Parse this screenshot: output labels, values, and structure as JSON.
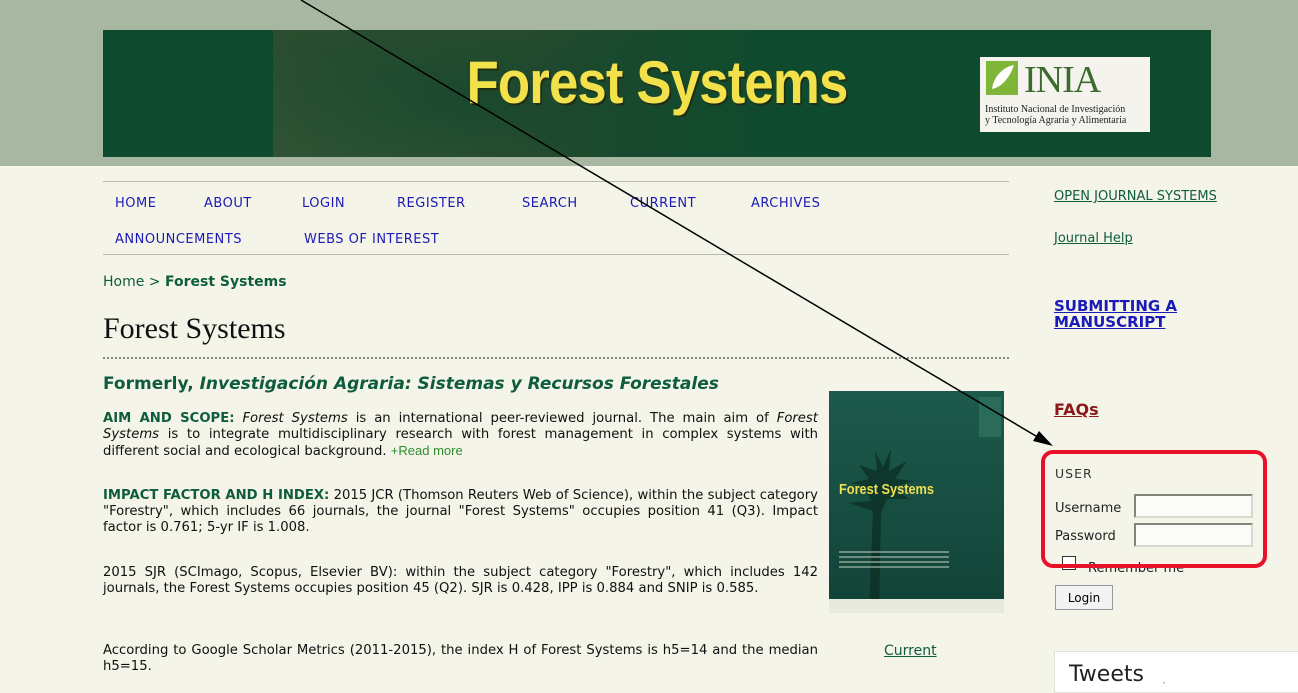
{
  "header": {
    "banner_title": "Forest Systems",
    "logo_word": "INIA",
    "logo_sub_line1": "Instituto Nacional de Investigación",
    "logo_sub_line2": "y Tecnología Agraria y Alimentaria"
  },
  "nav": {
    "items": [
      "HOME",
      "ABOUT",
      "LOGIN",
      "REGISTER",
      "SEARCH",
      "CURRENT",
      "ARCHIVES",
      "ANNOUNCEMENTS",
      "WEBS OF INTEREST"
    ]
  },
  "breadcrumb": {
    "home": "Home",
    "separator": ">",
    "current": "Forest Systems"
  },
  "main": {
    "page_title": "Forest Systems",
    "formerly_prefix": "Formerly,",
    "formerly_name": "Investigación Agraria: Sistemas y Recursos Forestales",
    "aim_lead": "AIM AND SCOPE:",
    "aim_journal": "Forest Systems",
    "aim_text1": "is an international peer-reviewed journal. The main aim of",
    "aim_journal2": "Forest Systems",
    "aim_text2": "is to integrate multidisciplinary research with forest management in complex systems with different social and ecological background.",
    "read_more": "+Read more",
    "impact_lead": "IMPACT FACTOR AND H INDEX:",
    "impact_text": "2015 JCR (Thomson Reuters Web of Science), within the subject category \"Forestry\", which includes 66 journals, the journal \"Forest Systems\" occupies position 41 (Q3). Impact factor is 0.761; 5-yr IF is 1.008.",
    "sjr_text": "2015 SJR (SCImago, Scopus, Elsevier BV): within the subject category \"Forestry\", which includes 142 journals, the Forest Systems occupies position 45 (Q2). SJR is 0.428, IPP is 0.884 and SNIP is 0.585.",
    "scholar_text": "According to Google Scholar Metrics (2011-2015), the index H of Forest Systems is h5=14 and the median h5=15.",
    "cover_title": "Forest Systems",
    "current_link": "Current"
  },
  "sidebar": {
    "ojs_link": "OPEN JOURNAL SYSTEMS",
    "journal_help": "Journal Help",
    "submitting": "SUBMITTING A MANUSCRIPT",
    "faqs": "FAQs",
    "user_heading": "USER",
    "username_label": "Username",
    "username_value": "",
    "password_label": "Password",
    "password_value": "",
    "remember_label": "Remember me",
    "login_button": "Login",
    "tweets_title": "Tweets",
    "tweets_dot": "·"
  },
  "colors": {
    "banner_green": "#0e4a2e",
    "banner_title_yellow": "#f2e14b",
    "link_blue": "#1a1ab8",
    "journal_green": "#0e5c3e",
    "highlight_red": "#e8112a",
    "faq_red": "#8b1a1a"
  }
}
